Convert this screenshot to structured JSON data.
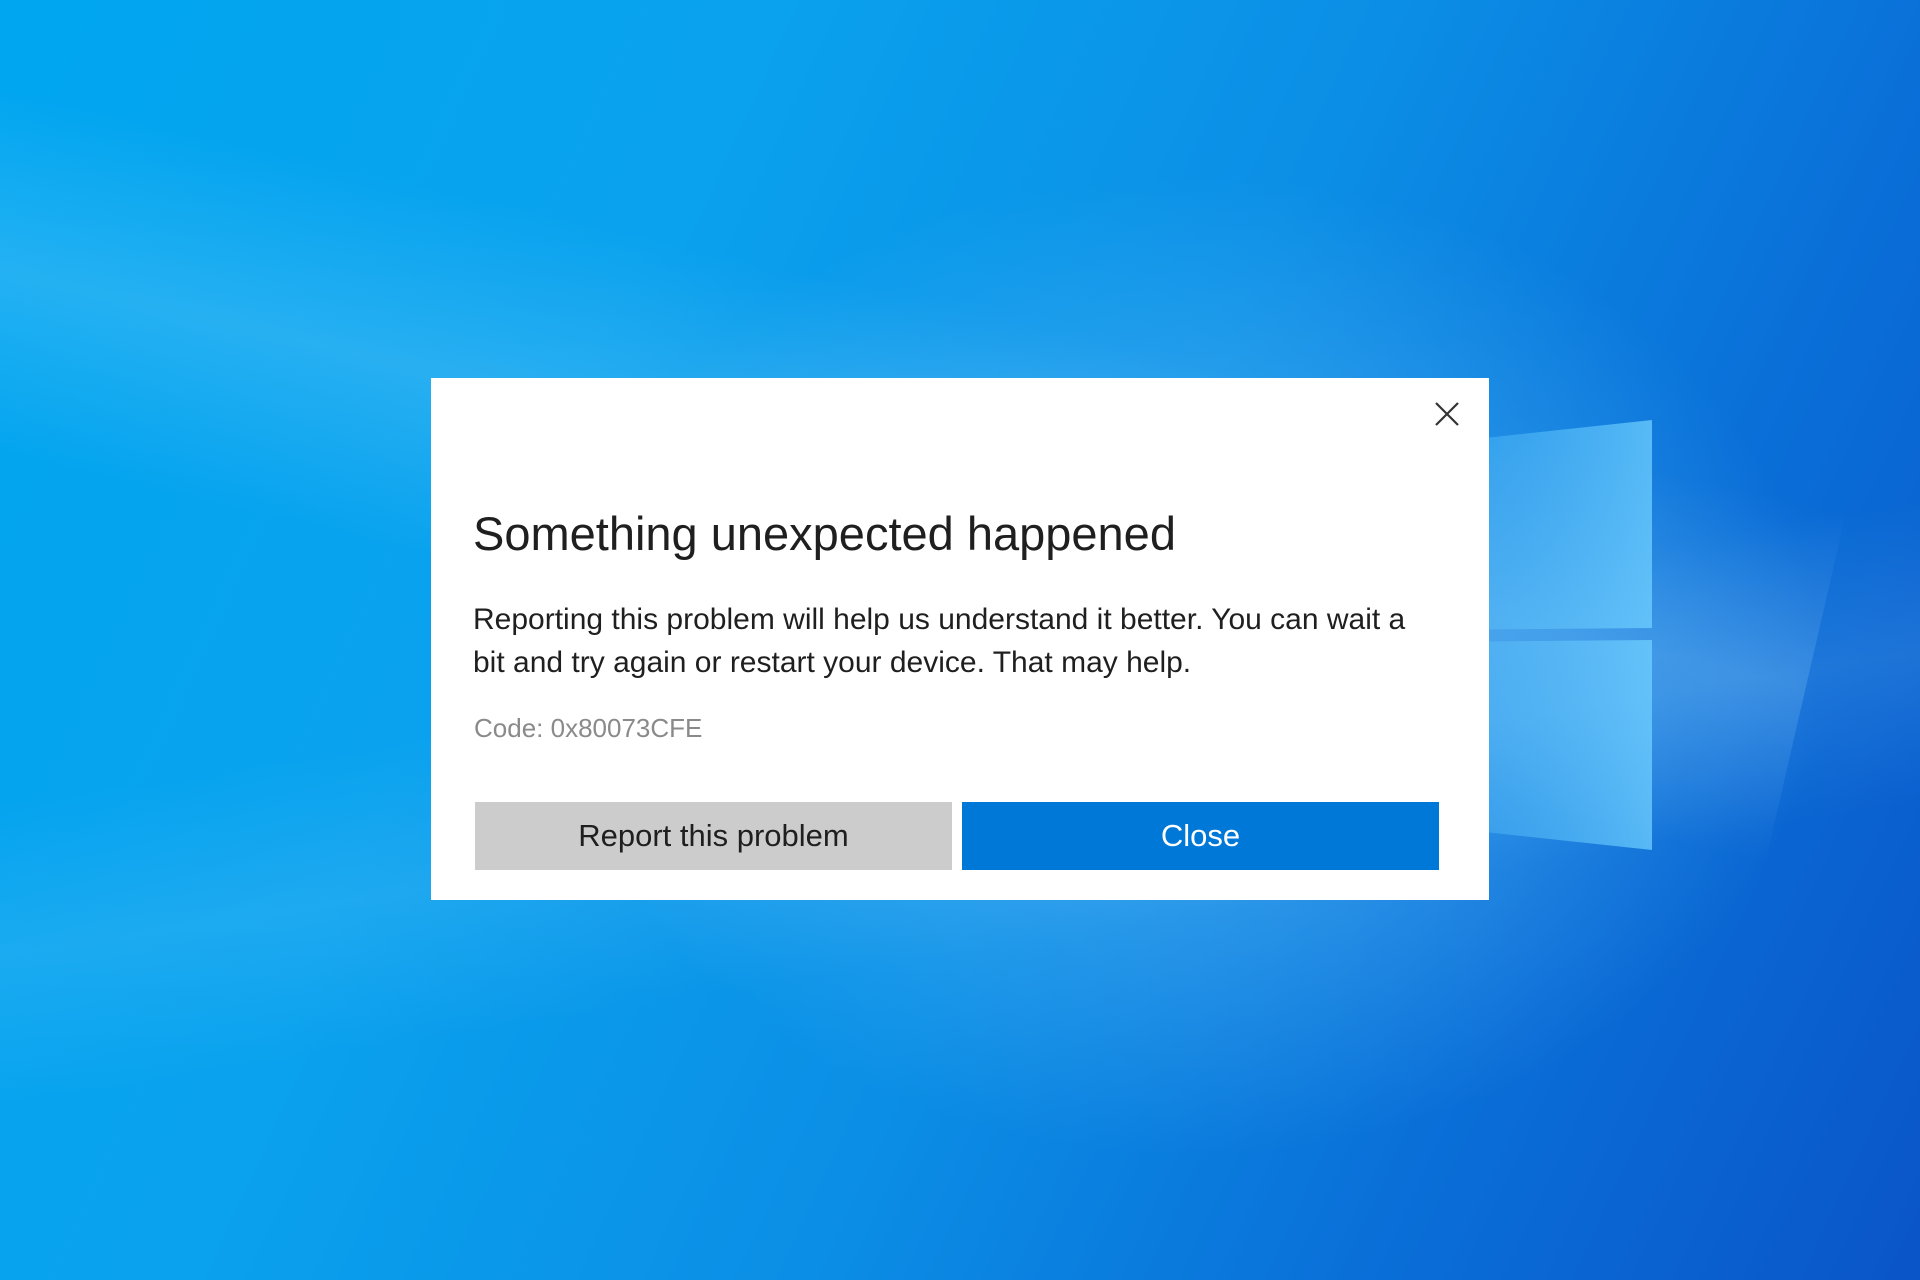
{
  "desktop": {
    "accent_color": "#0a8fe6",
    "logo_icon": "windows-logo-icon"
  },
  "dialog": {
    "close_icon": "close-icon",
    "title": "Something unexpected happened",
    "message": "Reporting this problem will help us understand it better. You can wait a bit and try again or restart your device. That may help.",
    "code": "Code: 0x80073CFE",
    "report_button_label": "Report this problem",
    "close_button_label": "Close",
    "report_button_color": "#cccccc",
    "close_button_color": "#0078d7"
  }
}
